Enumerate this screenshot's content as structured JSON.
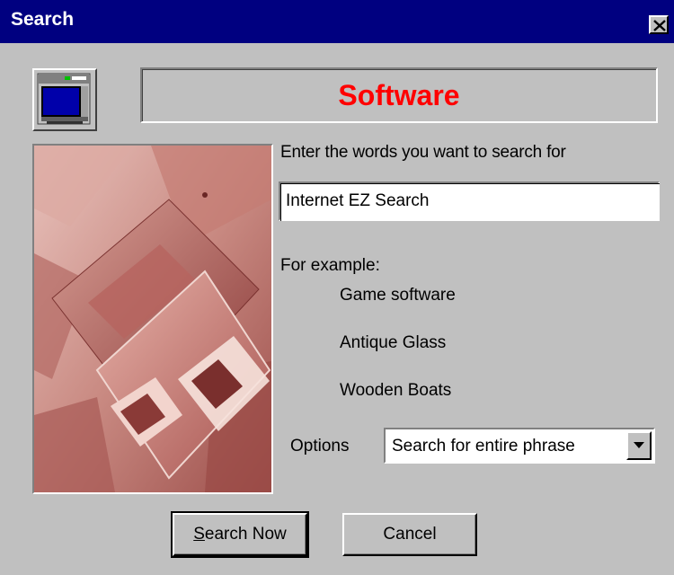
{
  "window": {
    "title": "Search"
  },
  "category": {
    "title": "Software",
    "color": "#ff0000"
  },
  "prompt": "Enter the words you want to search for",
  "search": {
    "value": "Internet EZ Search",
    "placeholder": ""
  },
  "examples": {
    "label": "For example:",
    "items": [
      "Game software",
      "Antique Glass",
      "Wooden Boats"
    ]
  },
  "options": {
    "label": "Options",
    "selected": "Search for entire phrase"
  },
  "buttons": {
    "search_now_mnemonic": "S",
    "search_now_rest": "earch Now",
    "cancel": "Cancel"
  },
  "icons": {
    "close": "close-icon",
    "app": "computer-monitor-icon",
    "dropdown": "chevron-down-icon",
    "photo": "floppy-disks-photo"
  },
  "colors": {
    "titlebar": "#000080",
    "face": "#c0c0c0",
    "photo_tint": "#b86a66"
  }
}
